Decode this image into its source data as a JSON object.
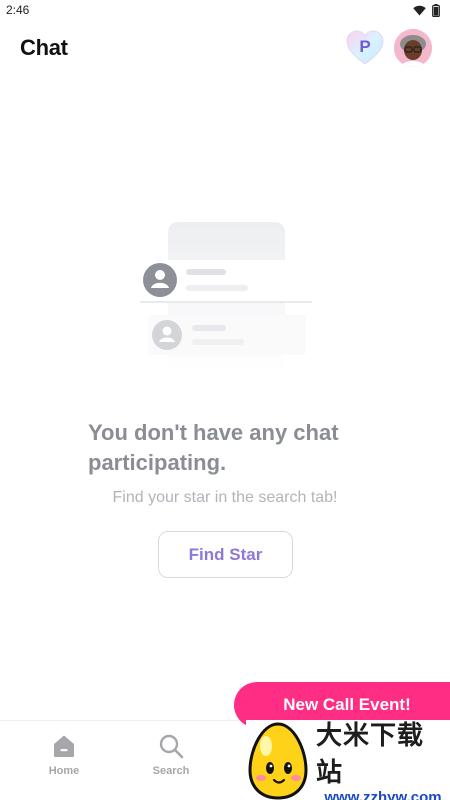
{
  "status_bar": {
    "time": "2:46"
  },
  "header": {
    "title": "Chat",
    "premium_badge_letter": "P"
  },
  "empty_state": {
    "title": "You don't have any chat participating.",
    "subtitle": "Find your star in the search tab!",
    "button_label": "Find Star"
  },
  "promo": {
    "label": "New Call Event!"
  },
  "bottom_nav": {
    "items": [
      {
        "label": "Home",
        "icon": "home-icon"
      },
      {
        "label": "Search",
        "icon": "search-icon"
      }
    ]
  },
  "watermark": {
    "chinese": "大米下载站",
    "url": "www.zzhyw.com"
  },
  "colors": {
    "accent_purple": "#8f78d6",
    "promo_pink": "#ff2d84",
    "muted_text": "#8a8d94"
  }
}
